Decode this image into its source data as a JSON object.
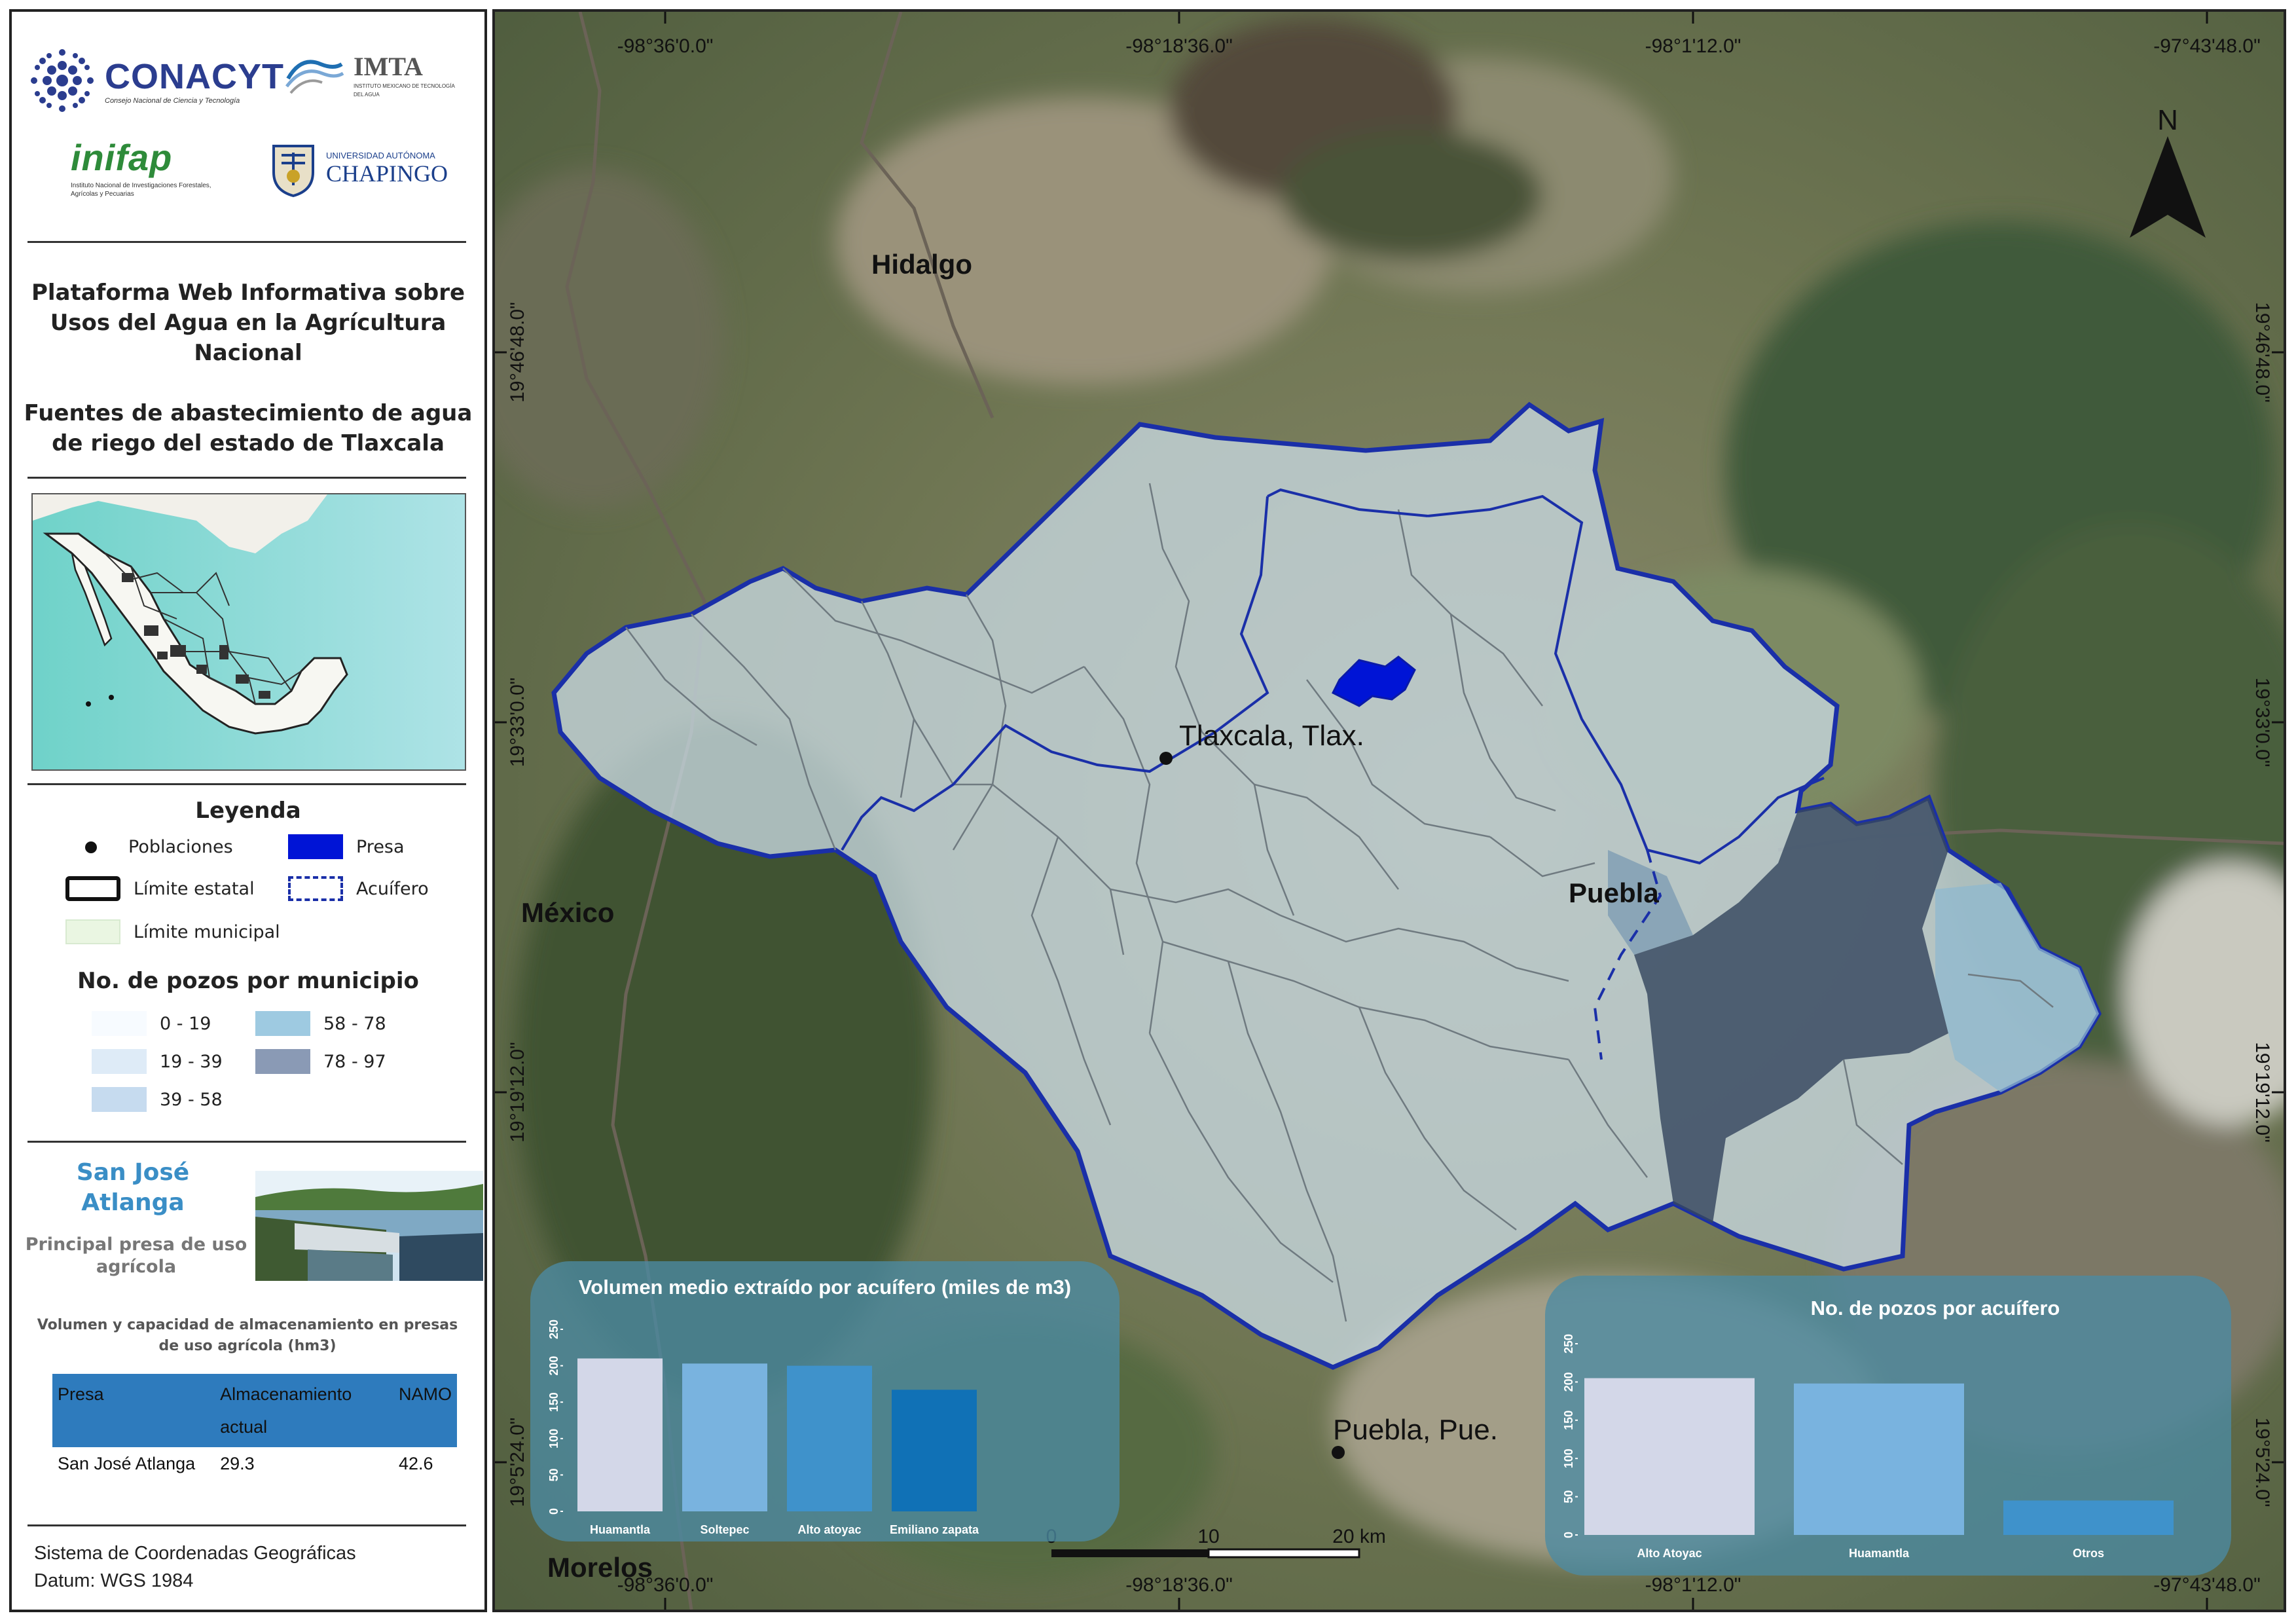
{
  "logos": {
    "conacyt": {
      "name": "CONACYT",
      "sub": "Consejo Nacional de Ciencia y Tecnología"
    },
    "imta": {
      "name": "IMTA",
      "sub": "INSTITUTO MEXICANO DE TECNOLOGÍA DEL AGUA"
    },
    "inifap": {
      "name": "inifap",
      "sub": "Instituto Nacional de Investigaciones Forestales, Agrícolas y Pecuarias"
    },
    "chapingo": {
      "pre": "UNIVERSIDAD AUTÓNOMA",
      "name": "CHAPINGO"
    }
  },
  "title": {
    "line1": "Plataforma Web Informativa sobre",
    "line2": "Usos del Agua en la Agrícultura",
    "line3": "Nacional",
    "line4": "Fuentes de abastecimiento de agua",
    "line5": "de riego del estado de Tlaxcala"
  },
  "legend": {
    "title": "Leyenda",
    "poblaciones": "Poblaciones",
    "presa": "Presa",
    "limite_estatal": "Límite estatal",
    "acuifero": "Acuífero",
    "limite_municipal": "Límite municipal",
    "pozos_title": "No. de pozos por municipio",
    "classes": [
      {
        "label": "0 - 19",
        "color": "#f7fbff"
      },
      {
        "label": "19 - 39",
        "color": "#deebf7"
      },
      {
        "label": "39 - 58",
        "color": "#c6dbef"
      },
      {
        "label": "58 - 78",
        "color": "#9ecae1"
      },
      {
        "label": "78 - 97",
        "color": "#8a9ab5"
      }
    ]
  },
  "dam": {
    "name1": "San José",
    "name2": "Atlanga",
    "desc1": "Principal presa de uso",
    "desc2": "agrícola"
  },
  "table": {
    "title1": "Volumen y capacidad de almacenamiento en presas",
    "title2": "de uso agrícola (hm3)",
    "headers": [
      "Presa",
      "Almacenamiento actual",
      "NAMO"
    ],
    "rows": [
      [
        "San José Atlanga",
        "29.3",
        "42.6"
      ]
    ]
  },
  "crs": {
    "line1": "Sistema de Coordenadas Geográficas",
    "line2": "Datum: WGS 1984"
  },
  "map": {
    "ticks_top": [
      "-98°36'0.0\"",
      "-98°18'36.0\"",
      "-98°1'12.0\"",
      "-97°43'48.0\""
    ],
    "ticks_bottom": [
      "-98°36'0.0\"",
      "-98°18'36.0\"",
      "-98°1'12.0\"",
      "-97°43'48.0\""
    ],
    "ticks_left": [
      "19°46'48.0\"",
      "19°33'0.0\"",
      "19°19'12.0\"",
      "19°5'24.0\""
    ],
    "ticks_right": [
      "19°46'48.0\"",
      "19°33'0.0\"",
      "19°19'12.0\"",
      "19°5'24.0\""
    ],
    "states": {
      "hidalgo": "Hidalgo",
      "mexico": "México",
      "puebla": "Puebla",
      "morelos": "Morelos"
    },
    "cities": {
      "tlaxcala": "Tlaxcala, Tlax.",
      "puebla": "Puebla, Pue."
    },
    "north": "N",
    "scale": [
      "0",
      "10",
      "20 km"
    ]
  },
  "chart_data": [
    {
      "type": "bar",
      "title": "Volumen medio extraído por acuífero (miles de m3)",
      "categories": [
        "Huamantla",
        "Soltepec",
        "Alto atoyac",
        "Emiliano zapata"
      ],
      "values": [
        210,
        203,
        200,
        167
      ],
      "colors": [
        "#d3d7e8",
        "#79b3df",
        "#3f92cb",
        "#1071b6"
      ],
      "yticks": [
        "0",
        "50",
        "100",
        "150",
        "200",
        "250"
      ],
      "ylim": [
        0,
        250
      ]
    },
    {
      "type": "bar",
      "title": "No. de pozos por acuífero",
      "categories": [
        "Alto Atoyac",
        "Huamantla",
        "Otros"
      ],
      "values": [
        205,
        198,
        45
      ],
      "colors": [
        "#d3d7e8",
        "#79b3df",
        "#3f92cb"
      ],
      "yticks": [
        "0",
        "50",
        "100",
        "150",
        "200",
        "250"
      ],
      "ylim": [
        0,
        250
      ]
    }
  ]
}
